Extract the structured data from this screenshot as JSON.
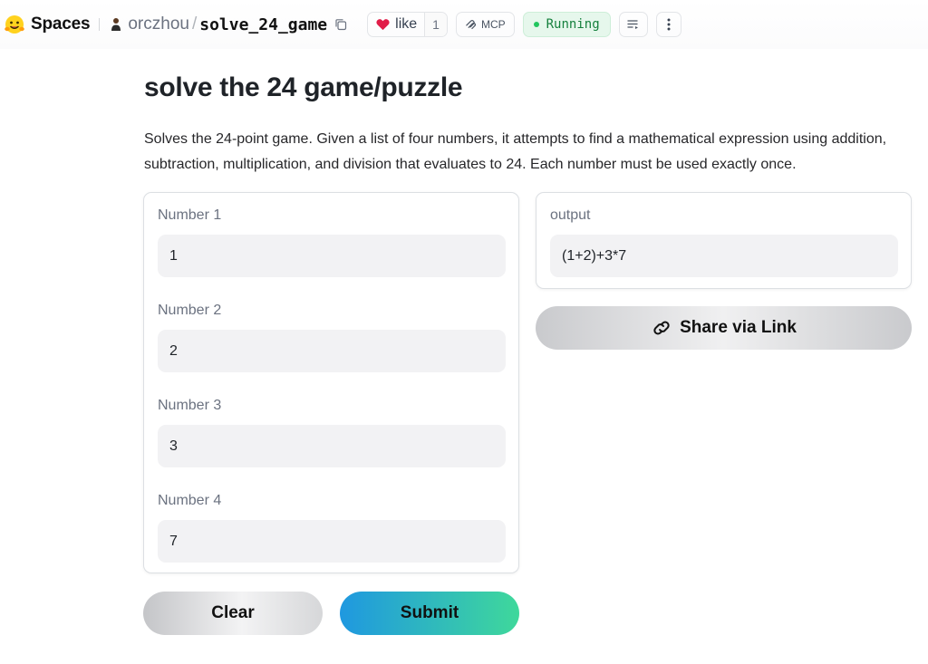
{
  "topbar": {
    "spaces_label": "Spaces",
    "owner": "orczhou",
    "slash": "/",
    "repo": "solve_24_game",
    "like_label": "like",
    "like_count": "1",
    "mcp_label": "MCP",
    "status_label": "Running"
  },
  "page": {
    "title": "solve the 24 game/puzzle",
    "description": "Solves the 24-point game. Given a list of four numbers, it attempts to find a mathematical expression using addition, subtraction, multiplication, and division that evaluates to 24. Each number must be used exactly once."
  },
  "inputs": [
    {
      "label": "Number 1",
      "value": "1"
    },
    {
      "label": "Number 2",
      "value": "2"
    },
    {
      "label": "Number 3",
      "value": "3"
    },
    {
      "label": "Number 4",
      "value": "7"
    }
  ],
  "output": {
    "label": "output",
    "value": "(1+2)+3*7"
  },
  "buttons": {
    "share": "Share via Link",
    "clear": "Clear",
    "submit": "Submit"
  },
  "colors": {
    "status_green": "#15803d",
    "submit_gradient_start": "#1f98e0",
    "submit_gradient_end": "#3fd89b",
    "heart_red": "#e11d48"
  }
}
